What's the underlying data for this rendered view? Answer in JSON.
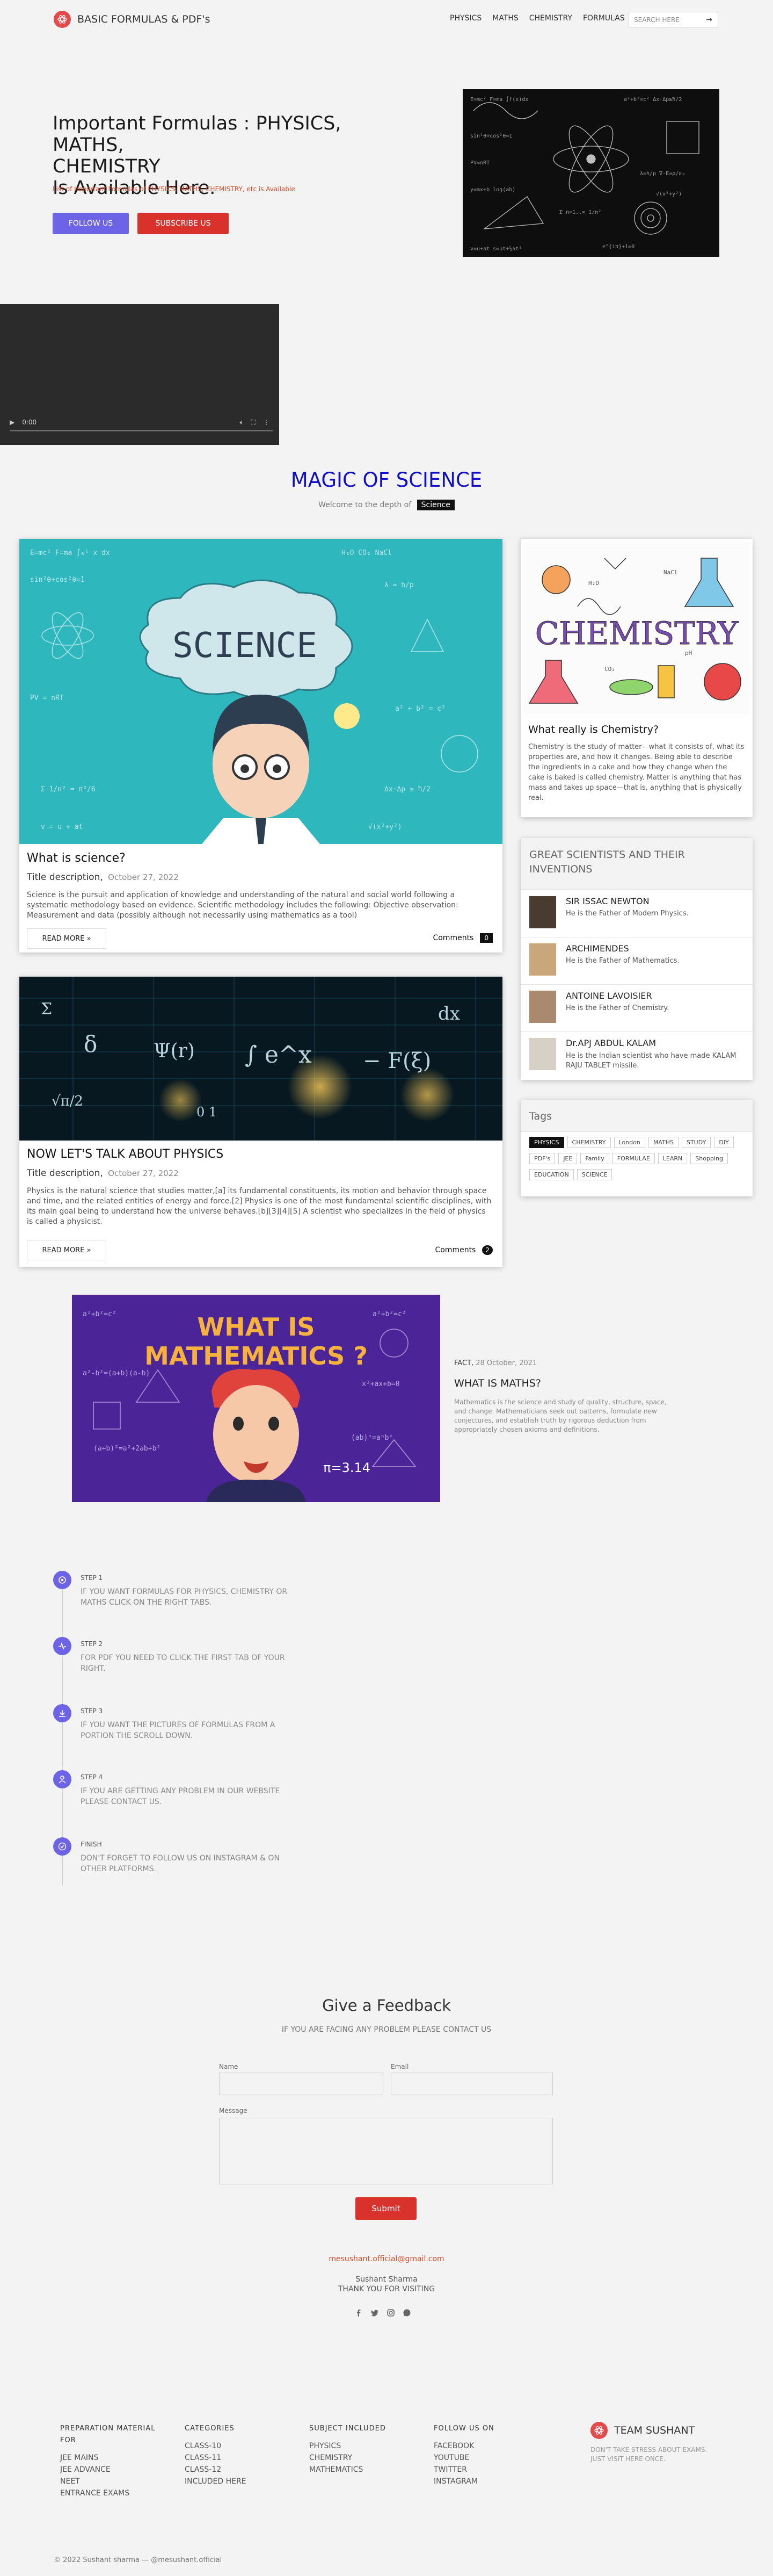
{
  "header": {
    "logo_text": "BASIC FORMULAS & PDF's",
    "nav": [
      "PHYSICS",
      "MATHS",
      "CHEMISTRY",
      "FORMULAS"
    ],
    "search_placeholder": "SEARCH HERE"
  },
  "hero": {
    "title_line1": "Important Formulas : PHYSICS, MATHS,",
    "title_line2": "CHEMISTRY",
    "title_line3": "Is Available Here.",
    "subtitle": "List of Important Formulas of PHYSICS, MATHS, CHEMISTRY, etc is Available",
    "follow_label": "FOLLOW US",
    "subscribe_label": "SUBSCRIBE US"
  },
  "video": {
    "time": "0:00"
  },
  "magic": {
    "title": "MAGIC OF SCIENCE",
    "subtitle": "Welcome to the depth of",
    "tag": "Science"
  },
  "posts": [
    {
      "image_word": "SCIENCE",
      "title": "What is science?",
      "desc_label": "Title description,",
      "date": "October 27, 2022",
      "text": "Science is the pursuit and application of knowledge and understanding of the natural and social world following a systematic methodology based on evidence. Scientific methodology includes the following: Objective observation: Measurement and data (possibly although not necessarily using mathematics as a tool)",
      "read_more": "READ MORE »",
      "comments_label": "Comments",
      "comments_count": "0"
    },
    {
      "title": "NOW LET'S TALK ABOUT PHYSICS",
      "desc_label": "Title description,",
      "date": "October 27, 2022",
      "text": "Physics is the natural science that studies matter,[a] its fundamental constituents, its motion and behavior through space and time, and the related entities of energy and force.[2] Physics is one of the most fundamental scientific disciplines, with its main goal being to understand how the universe behaves.[b][3][4][5] A scientist who specializes in the field of physics is called a physicist.",
      "read_more": "READ MORE »",
      "comments_label": "Comments",
      "comments_count": "2"
    }
  ],
  "sidebar": {
    "chem_image_word": "CHEMISTRY",
    "chem_title": "What really is Chemistry?",
    "chem_text": "Chemistry is the study of matter—what it consists of, what its properties are, and how it changes. Being able to describe the ingredients in a cake and how they change when the cake is baked is called chemistry. Matter is anything that has mass and takes up space—that is, anything that is physically real.",
    "scientists_title": "GREAT SCIENTISTS AND THEIR INVENTIONS",
    "scientists": [
      {
        "name": "SIR ISSAC NEWTON",
        "desc": "He is the Father of Modern Physics."
      },
      {
        "name": "ARCHIMENDES",
        "desc": "He is the Father of Mathematics."
      },
      {
        "name": "ANTOINE LAVOISIER",
        "desc": "He is the Father of Chemistry."
      },
      {
        "name": "Dr.APJ ABDUL KALAM",
        "desc": "He is the Indian scientist who have made KALAM RAJU TABLET missile."
      }
    ],
    "tags_title": "Tags",
    "tags": [
      "PHYSICS",
      "CHEMISTRY",
      "London",
      "MATHS",
      "STUDY",
      "DIY",
      "PDF's",
      "JEE",
      "Family",
      "FORMULAE",
      "LEARN",
      "Shopping",
      "EDUCATION",
      "SCIENCE"
    ]
  },
  "math": {
    "image_line1": "WHAT IS",
    "image_line2": "MATHEMATICS ?",
    "image_formula": "π=3.14",
    "meta_tag": "FACT,",
    "meta_date": "28 October, 2021",
    "title": "WHAT IS MATHS?",
    "text": "Mathematics is the science and study of quality, structure, space, and change. Mathematicians seek out patterns, formulate new conjectures, and establish truth by rigorous deduction from appropriately chosen axioms and definitions."
  },
  "steps": [
    {
      "label": "STEP 1",
      "text": "IF YOU WANT FORMULAS FOR PHYSICS, CHEMISTRY OR MATHS CLICK ON THE RIGHT TABS."
    },
    {
      "label": "STEP 2",
      "text": "FOR PDF YOU NEED TO CLICK THE FIRST TAB OF YOUR RIGHT."
    },
    {
      "label": "STEP 3",
      "text": "IF YOU WANT THE PICTURES OF FORMULAS FROM A PORTION THE SCROLL DOWN."
    },
    {
      "label": "STEP 4",
      "text": "IF YOU ARE GETTING ANY PROBLEM IN OUR WEBSITE PLEASE CONTACT US."
    },
    {
      "label": "FINISH",
      "text": "DON'T FORGET TO FOLLOW US ON INSTAGRAM & ON OTHER PLATFORMS."
    }
  ],
  "feedback": {
    "title": "Give a Feedback",
    "subtitle": "IF YOU ARE FACING ANY PROBLEM PLEASE CONTACT US",
    "name_label": "Name",
    "email_label": "Email",
    "message_label": "Message",
    "submit_label": "Submit",
    "email": "mesushant.official@gmail.com",
    "author": "Sushant Sharma",
    "thanks": "THANK YOU FOR VISITING"
  },
  "footer": {
    "col1": {
      "title": "PREPARATION MATERIAL FOR",
      "items": [
        "JEE MAINS",
        "JEE ADVANCE",
        "NEET",
        "ENTRANCE EXAMS"
      ]
    },
    "col2": {
      "title": "CATEGORIES",
      "items": [
        "CLASS-10",
        "CLASS-11",
        "CLASS-12",
        "INCLUDED HERE"
      ]
    },
    "col3": {
      "title": "SUBJECT INCLUDED",
      "items": [
        "PHYSICS",
        "CHEMISTRY",
        "MATHEMATICS"
      ]
    },
    "col4": {
      "title": "FOLLOW US ON",
      "items": [
        "FACEBOOK",
        "YOUTUBE",
        "TWITTER",
        "INSTAGRAM"
      ]
    },
    "brand": "TEAM SUSHANT",
    "brand_text": "DON'T TAKE STRESS ABOUT EXAMS. JUST VISIT HERE ONCE.",
    "copyright": "© 2022 Sushant sharma — @mesushant.official"
  },
  "colors": {
    "accent": "#6c63e6",
    "red": "#d9322c",
    "magic_blue": "#1010c8"
  }
}
